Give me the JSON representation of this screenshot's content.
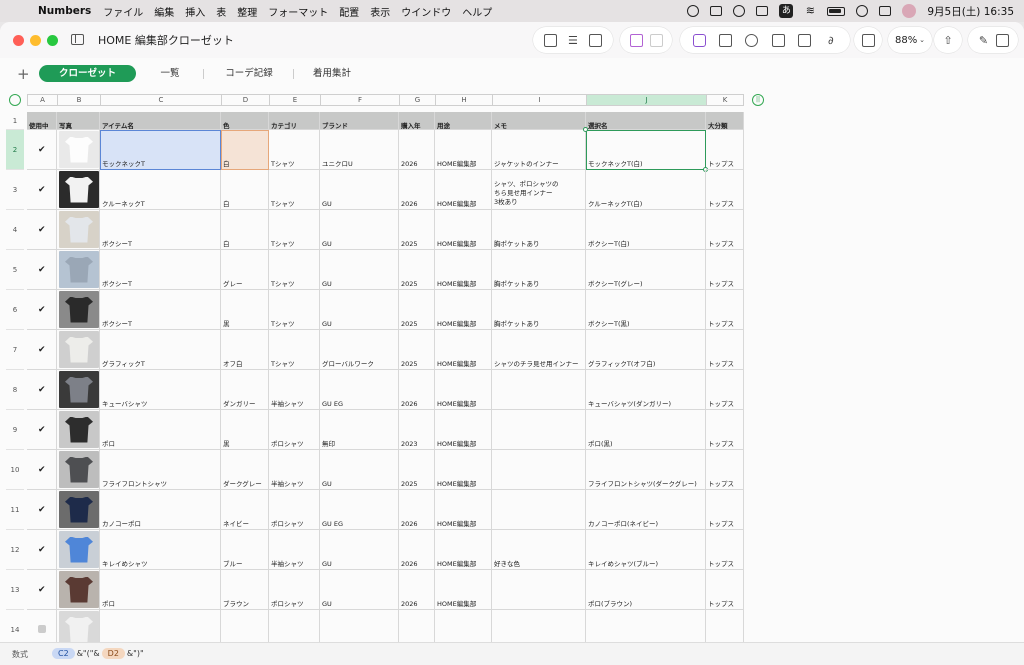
{
  "menubar": {
    "app_name": "Numbers",
    "items": [
      "ファイル",
      "編集",
      "挿入",
      "表",
      "整理",
      "フォーマット",
      "配置",
      "表示",
      "ウインドウ",
      "ヘルプ"
    ],
    "ime_label": "あ",
    "clock": "9月5日(土)  16:35"
  },
  "window": {
    "title": "HOME 編集部クローゼット",
    "zoom": "88%"
  },
  "tabs": [
    {
      "label": "クローゼット",
      "active": true
    },
    {
      "label": "一覧",
      "active": false
    },
    {
      "label": "コーデ記録",
      "active": false
    },
    {
      "label": "着用集計",
      "active": false
    }
  ],
  "columns": [
    "A",
    "B",
    "C",
    "D",
    "E",
    "F",
    "G",
    "H",
    "I",
    "J",
    "K"
  ],
  "selected_column": "J",
  "headers": [
    "使用中",
    "写真",
    "アイテム名",
    "色",
    "カテゴリ",
    "ブランド",
    "購入年",
    "用途",
    "メモ",
    "選択名",
    "大分類"
  ],
  "rows": [
    {
      "num": "2",
      "checked": true,
      "thumb": "#e9e9e9",
      "shirt": "#fdfdfd",
      "name": "モックネックT",
      "color": "白",
      "category": "Tシャツ",
      "brand": "ユニクロU",
      "year": "2026",
      "use": "HOME編集部",
      "memo": "ジャケットのインナー",
      "select": "モックネックT(白)",
      "major": "トップス"
    },
    {
      "num": "3",
      "checked": true,
      "thumb": "#2b2b2b",
      "shirt": "#f2f2f2",
      "name": "クルーネックT",
      "color": "白",
      "category": "Tシャツ",
      "brand": "GU",
      "year": "2026",
      "use": "HOME編集部",
      "memo": "シャツ、ポロシャツの\nちら見せ用インナー\n3枚あり",
      "select": "クルーネックT(白)",
      "major": "トップス"
    },
    {
      "num": "4",
      "checked": true,
      "thumb": "#d7d2c8",
      "shirt": "#e3e6ea",
      "name": "ボクシーT",
      "color": "白",
      "category": "Tシャツ",
      "brand": "GU",
      "year": "2025",
      "use": "HOME編集部",
      "memo": "胸ポケットあり",
      "select": "ボクシーT(白)",
      "major": "トップス"
    },
    {
      "num": "5",
      "checked": true,
      "thumb": "#b5c3d2",
      "shirt": "#9aa7b6",
      "name": "ボクシーT",
      "color": "グレー",
      "category": "Tシャツ",
      "brand": "GU",
      "year": "2025",
      "use": "HOME編集部",
      "memo": "胸ポケットあり",
      "select": "ボクシーT(グレー)",
      "major": "トップス"
    },
    {
      "num": "6",
      "checked": true,
      "thumb": "#8a8a8a",
      "shirt": "#2a2a2a",
      "name": "ボクシーT",
      "color": "黒",
      "category": "Tシャツ",
      "brand": "GU",
      "year": "2025",
      "use": "HOME編集部",
      "memo": "胸ポケットあり",
      "select": "ボクシーT(黒)",
      "major": "トップス"
    },
    {
      "num": "7",
      "checked": true,
      "thumb": "#cfcfcf",
      "shirt": "#ededea",
      "name": "グラフィックT",
      "color": "オフ白",
      "category": "Tシャツ",
      "brand": "グローバルワーク",
      "year": "2025",
      "use": "HOME編集部",
      "memo": "シャツのチラ見せ用インナー",
      "select": "グラフィックT(オフ白)",
      "major": "トップス"
    },
    {
      "num": "8",
      "checked": true,
      "thumb": "#3a3a3a",
      "shirt": "#7d8088",
      "name": "キューバシャツ",
      "color": "ダンガリー",
      "category": "半袖シャツ",
      "brand": "GU EG",
      "year": "2026",
      "use": "HOME編集部",
      "memo": "",
      "select": "キューバシャツ(ダンガリー)",
      "major": "トップス"
    },
    {
      "num": "9",
      "checked": true,
      "thumb": "#c8c8c8",
      "shirt": "#2d2d2d",
      "name": "ポロ",
      "color": "黒",
      "category": "ポロシャツ",
      "brand": "無印",
      "year": "2023",
      "use": "HOME編集部",
      "memo": "",
      "select": "ポロ(黒)",
      "major": "トップス"
    },
    {
      "num": "10",
      "checked": true,
      "thumb": "#bdbdbd",
      "shirt": "#4e4f52",
      "name": "フライフロントシャツ",
      "color": "ダークグレー",
      "category": "半袖シャツ",
      "brand": "GU",
      "year": "2025",
      "use": "HOME編集部",
      "memo": "",
      "select": "フライフロントシャツ(ダークグレー)",
      "major": "トップス"
    },
    {
      "num": "11",
      "checked": true,
      "thumb": "#6c6c6c",
      "shirt": "#1e2b4a",
      "name": "カノコーポロ",
      "color": "ネイビー",
      "category": "ポロシャツ",
      "brand": "GU EG",
      "year": "2026",
      "use": "HOME編集部",
      "memo": "",
      "select": "カノコーポロ(ネイビー)",
      "major": "トップス"
    },
    {
      "num": "12",
      "checked": true,
      "thumb": "#c9cfd6",
      "shirt": "#4f86d8",
      "name": "キレイめシャツ",
      "color": "ブルー",
      "category": "半袖シャツ",
      "brand": "GU",
      "year": "2026",
      "use": "HOME編集部",
      "memo": "好きな色",
      "select": "キレイめシャツ(ブルー)",
      "major": "トップス"
    },
    {
      "num": "13",
      "checked": true,
      "thumb": "#b9b3ad",
      "shirt": "#5a3a33",
      "name": "ポロ",
      "color": "ブラウン",
      "category": "ポロシャツ",
      "brand": "GU",
      "year": "2026",
      "use": "HOME編集部",
      "memo": "",
      "select": "ポロ(ブラウン)",
      "major": "トップス"
    },
    {
      "num": "14",
      "checked": false,
      "thumb": "#d9d9d9",
      "shirt": "#f1f1f1",
      "name": "",
      "color": "",
      "category": "",
      "brand": "",
      "year": "",
      "use": "",
      "memo": "",
      "select": "",
      "major": ""
    }
  ],
  "formula": {
    "label": "数式",
    "ref1": "C2",
    "mid": "&\"(\"&",
    "ref2": "D2",
    "tail": "&\")\""
  },
  "colors": {
    "accent": "#1f9b57",
    "selection_blue": "#5b86d6",
    "selection_orange": "#e6a77a"
  }
}
